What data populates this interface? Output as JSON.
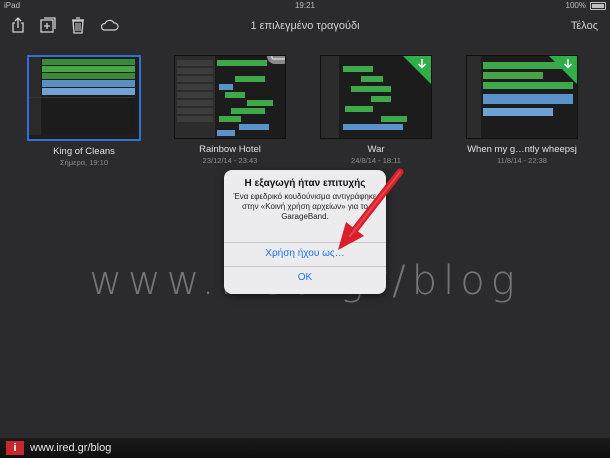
{
  "statusbar": {
    "device": "iPad",
    "time": "19:21",
    "battery": "100%"
  },
  "toolbar": {
    "title": "1 επιλεγμένο τραγούδι",
    "done_label": "Τέλος"
  },
  "songs": [
    {
      "name": "King of Cleans",
      "date": "Σήμερα, 19:10",
      "selected": true
    },
    {
      "name": "Rainbow Hotel",
      "date": "23/12/14 - 23:43"
    },
    {
      "name": "War",
      "date": "24/8/14 - 18:11"
    },
    {
      "name": "When my g…ntly wheepsj",
      "date": "11/8/14 - 22:38"
    }
  ],
  "alert": {
    "title": "Η εξαγωγή ήταν επιτυχής",
    "message": "Ένα εφεδρικό κουδούνισμα αντιγράφηκε στην «Κοινή χρήση αρχείων» για το GarageBand.",
    "use_sound_label": "Χρήση ήχου ως…",
    "ok_label": "OK"
  },
  "watermark": "www.ired.gr/blog",
  "footer": {
    "logo": "i",
    "url": "www.ired.gr/blog"
  },
  "colors": {
    "accent": "#1a73e8",
    "selection": "#2f6fd6",
    "badge": "#2fae4a",
    "brand": "#c7282e"
  }
}
